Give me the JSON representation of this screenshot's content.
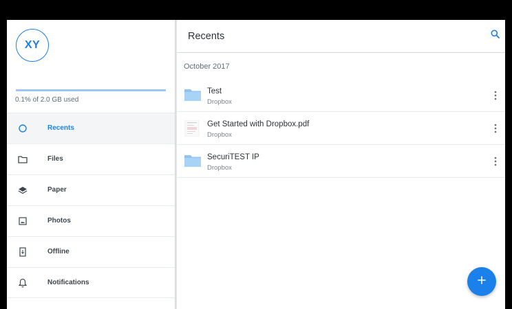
{
  "colors": {
    "accent": "#1b80ea",
    "folder": "#8fc4f5",
    "text": "#2d3339",
    "muted": "#7a858f"
  },
  "sidebar": {
    "avatar_initials": "XY",
    "usage": {
      "text": "0.1% of 2.0 GB used",
      "fraction": 0.001
    },
    "items": [
      {
        "label": "Recents",
        "icon": "clock-icon",
        "active": true
      },
      {
        "label": "Files",
        "icon": "folder-icon",
        "active": false
      },
      {
        "label": "Paper",
        "icon": "paper-icon",
        "active": false
      },
      {
        "label": "Photos",
        "icon": "photo-icon",
        "active": false
      },
      {
        "label": "Offline",
        "icon": "offline-icon",
        "active": false
      },
      {
        "label": "Notifications",
        "icon": "bell-icon",
        "active": false
      }
    ]
  },
  "header": {
    "title": "Recents",
    "search_icon": "search-icon"
  },
  "section": {
    "label": "October 2017"
  },
  "files": [
    {
      "name": "Test",
      "location": "Dropbox",
      "icon": "folder-icon"
    },
    {
      "name": "Get Started with Dropbox.pdf",
      "location": "Dropbox",
      "icon": "pdf-thumbnail-icon"
    },
    {
      "name": "SecuriTEST IP",
      "location": "Dropbox",
      "icon": "folder-icon"
    }
  ],
  "fab": {
    "icon": "plus-icon"
  }
}
